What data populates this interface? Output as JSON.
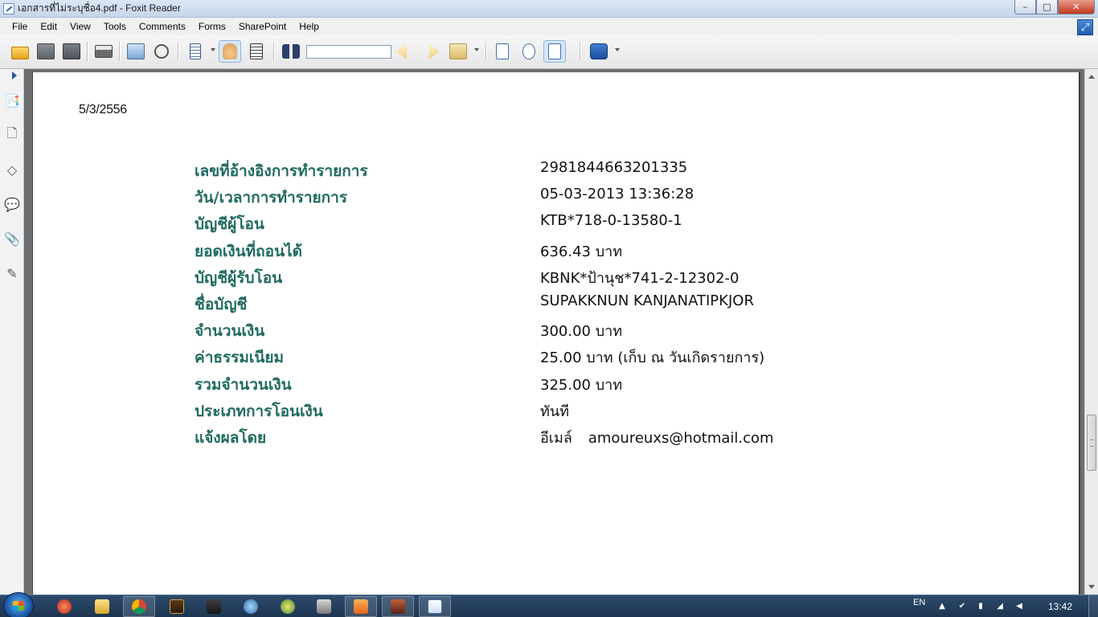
{
  "window": {
    "title": "เอกสารที่ไม่ระบุชื่อ4.pdf - Foxit Reader",
    "minimize": "–",
    "maximize": "□",
    "close": "✕"
  },
  "menu": [
    "File",
    "Edit",
    "View",
    "Tools",
    "Comments",
    "Forms",
    "SharePoint",
    "Help"
  ],
  "toolbar": {
    "search_value": "",
    "icons": [
      "open-icon",
      "save-icon",
      "save-as-icon",
      "print-icon",
      "presentation-icon",
      "find-glasses-icon",
      "page-view-icon",
      "hand-tool-icon",
      "select-text-icon",
      "binoculars-icon",
      "prev-result-icon",
      "next-result-icon",
      "clear-results-icon",
      "actual-size-icon",
      "fit-page-icon",
      "fit-width-icon",
      "foxit-logo-icon"
    ]
  },
  "left_panel": {
    "icons": [
      "bookmarks-icon",
      "pages-icon",
      "layers-icon",
      "comments-icon",
      "attachments-icon",
      "signatures-icon"
    ]
  },
  "document": {
    "date": "5/3/2556",
    "rows": [
      {
        "label": "เลขที่อ้างอิงการทำรายการ",
        "value": "2981844663201335"
      },
      {
        "label": "วัน/เวลาการทำรายการ",
        "value": "05-03-2013 13:36:28"
      },
      {
        "label": "บัญชีผู้โอน",
        "value": "KTB*718-0-13580-1"
      },
      {
        "label": "ยอดเงินที่ถอนได้",
        "value": "636.43 บาท"
      },
      {
        "label": "บัญชีผู้รับโอน",
        "value": "KBNK*ป้านุช*741-2-12302-0"
      },
      {
        "label": "ชื่อบัญชี",
        "value": "SUPAKKNUN KANJANATIPKJOR"
      },
      {
        "label": "จำนวนเงิน",
        "value": "300.00 บาท"
      },
      {
        "label": "ค่าธรรมเนียม",
        "value": "25.00 บาท (เก็บ ณ วันเกิดรายการ)"
      },
      {
        "label": "รวมจำนวนเงิน",
        "value": "325.00 บาท"
      },
      {
        "label": "ประเภทการโอนเงิน",
        "value": "ทันที"
      }
    ],
    "notify": {
      "label": "แจ้งผลโดย",
      "method": "อีเมล์",
      "email": "amoureuxs@hotmail.com"
    }
  },
  "taskbar": {
    "language": "EN",
    "clock": "13:42"
  },
  "colors": {
    "label_green": "#1f6a60",
    "viewer_gray": "#6f6f6f"
  }
}
